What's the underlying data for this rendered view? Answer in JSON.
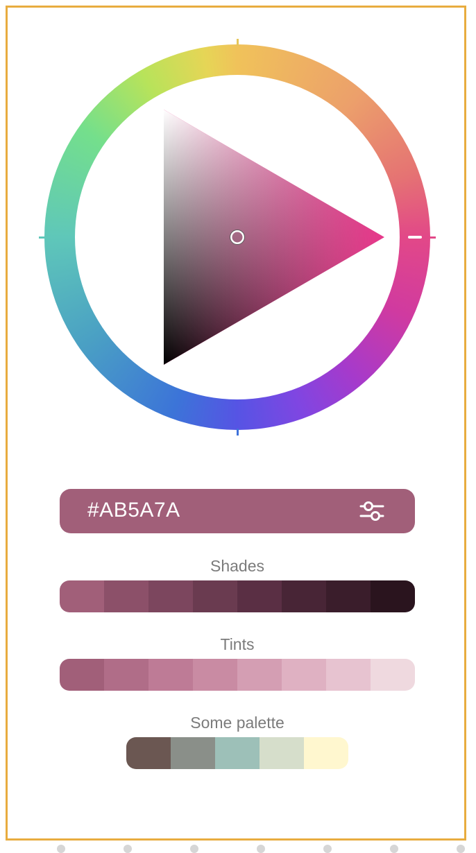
{
  "color_picker": {
    "hex_value": "#AB5A7A",
    "hue_color": "#e8388b",
    "selected_color": "#AB5A7A"
  },
  "settings_icon": "sliders-icon",
  "sections": {
    "shades": {
      "title": "Shades",
      "colors": [
        "#a15f79",
        "#8c5069",
        "#7c465e",
        "#6a3b50",
        "#5a2f44",
        "#482536",
        "#3a1d2b",
        "#2a141e"
      ]
    },
    "tints": {
      "title": "Tints",
      "colors": [
        "#a15f79",
        "#b06d88",
        "#be7b96",
        "#c98ba3",
        "#d49eb3",
        "#dfb1c2",
        "#e7c3d0",
        "#efd9df"
      ]
    },
    "palette": {
      "title": "Some palette",
      "colors": [
        "#6b5752",
        "#8a8f89",
        "#9dc0b8",
        "#d6decb",
        "#fff7cf"
      ]
    }
  }
}
